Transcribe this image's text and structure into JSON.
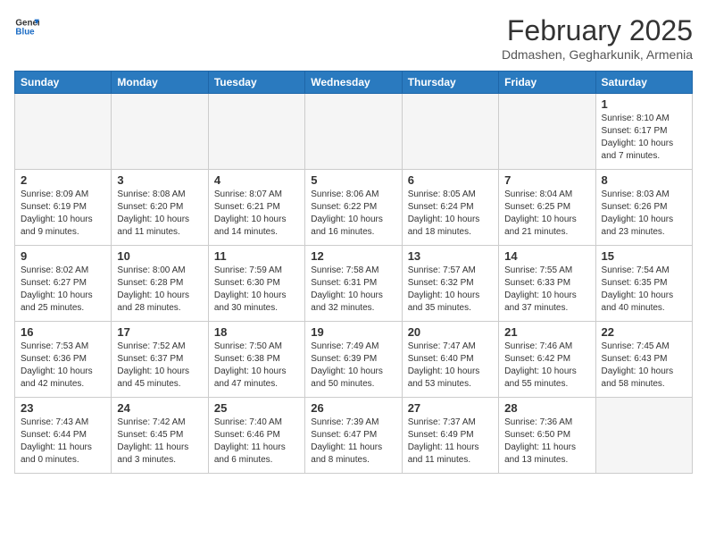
{
  "header": {
    "logo_general": "General",
    "logo_blue": "Blue",
    "month_title": "February 2025",
    "location": "Ddmashen, Gegharkunik, Armenia"
  },
  "days_of_week": [
    "Sunday",
    "Monday",
    "Tuesday",
    "Wednesday",
    "Thursday",
    "Friday",
    "Saturday"
  ],
  "weeks": [
    [
      {
        "day": "",
        "info": ""
      },
      {
        "day": "",
        "info": ""
      },
      {
        "day": "",
        "info": ""
      },
      {
        "day": "",
        "info": ""
      },
      {
        "day": "",
        "info": ""
      },
      {
        "day": "",
        "info": ""
      },
      {
        "day": "1",
        "info": "Sunrise: 8:10 AM\nSunset: 6:17 PM\nDaylight: 10 hours and 7 minutes."
      }
    ],
    [
      {
        "day": "2",
        "info": "Sunrise: 8:09 AM\nSunset: 6:19 PM\nDaylight: 10 hours and 9 minutes."
      },
      {
        "day": "3",
        "info": "Sunrise: 8:08 AM\nSunset: 6:20 PM\nDaylight: 10 hours and 11 minutes."
      },
      {
        "day": "4",
        "info": "Sunrise: 8:07 AM\nSunset: 6:21 PM\nDaylight: 10 hours and 14 minutes."
      },
      {
        "day": "5",
        "info": "Sunrise: 8:06 AM\nSunset: 6:22 PM\nDaylight: 10 hours and 16 minutes."
      },
      {
        "day": "6",
        "info": "Sunrise: 8:05 AM\nSunset: 6:24 PM\nDaylight: 10 hours and 18 minutes."
      },
      {
        "day": "7",
        "info": "Sunrise: 8:04 AM\nSunset: 6:25 PM\nDaylight: 10 hours and 21 minutes."
      },
      {
        "day": "8",
        "info": "Sunrise: 8:03 AM\nSunset: 6:26 PM\nDaylight: 10 hours and 23 minutes."
      }
    ],
    [
      {
        "day": "9",
        "info": "Sunrise: 8:02 AM\nSunset: 6:27 PM\nDaylight: 10 hours and 25 minutes."
      },
      {
        "day": "10",
        "info": "Sunrise: 8:00 AM\nSunset: 6:28 PM\nDaylight: 10 hours and 28 minutes."
      },
      {
        "day": "11",
        "info": "Sunrise: 7:59 AM\nSunset: 6:30 PM\nDaylight: 10 hours and 30 minutes."
      },
      {
        "day": "12",
        "info": "Sunrise: 7:58 AM\nSunset: 6:31 PM\nDaylight: 10 hours and 32 minutes."
      },
      {
        "day": "13",
        "info": "Sunrise: 7:57 AM\nSunset: 6:32 PM\nDaylight: 10 hours and 35 minutes."
      },
      {
        "day": "14",
        "info": "Sunrise: 7:55 AM\nSunset: 6:33 PM\nDaylight: 10 hours and 37 minutes."
      },
      {
        "day": "15",
        "info": "Sunrise: 7:54 AM\nSunset: 6:35 PM\nDaylight: 10 hours and 40 minutes."
      }
    ],
    [
      {
        "day": "16",
        "info": "Sunrise: 7:53 AM\nSunset: 6:36 PM\nDaylight: 10 hours and 42 minutes."
      },
      {
        "day": "17",
        "info": "Sunrise: 7:52 AM\nSunset: 6:37 PM\nDaylight: 10 hours and 45 minutes."
      },
      {
        "day": "18",
        "info": "Sunrise: 7:50 AM\nSunset: 6:38 PM\nDaylight: 10 hours and 47 minutes."
      },
      {
        "day": "19",
        "info": "Sunrise: 7:49 AM\nSunset: 6:39 PM\nDaylight: 10 hours and 50 minutes."
      },
      {
        "day": "20",
        "info": "Sunrise: 7:47 AM\nSunset: 6:40 PM\nDaylight: 10 hours and 53 minutes."
      },
      {
        "day": "21",
        "info": "Sunrise: 7:46 AM\nSunset: 6:42 PM\nDaylight: 10 hours and 55 minutes."
      },
      {
        "day": "22",
        "info": "Sunrise: 7:45 AM\nSunset: 6:43 PM\nDaylight: 10 hours and 58 minutes."
      }
    ],
    [
      {
        "day": "23",
        "info": "Sunrise: 7:43 AM\nSunset: 6:44 PM\nDaylight: 11 hours and 0 minutes."
      },
      {
        "day": "24",
        "info": "Sunrise: 7:42 AM\nSunset: 6:45 PM\nDaylight: 11 hours and 3 minutes."
      },
      {
        "day": "25",
        "info": "Sunrise: 7:40 AM\nSunset: 6:46 PM\nDaylight: 11 hours and 6 minutes."
      },
      {
        "day": "26",
        "info": "Sunrise: 7:39 AM\nSunset: 6:47 PM\nDaylight: 11 hours and 8 minutes."
      },
      {
        "day": "27",
        "info": "Sunrise: 7:37 AM\nSunset: 6:49 PM\nDaylight: 11 hours and 11 minutes."
      },
      {
        "day": "28",
        "info": "Sunrise: 7:36 AM\nSunset: 6:50 PM\nDaylight: 11 hours and 13 minutes."
      },
      {
        "day": "",
        "info": ""
      }
    ]
  ]
}
